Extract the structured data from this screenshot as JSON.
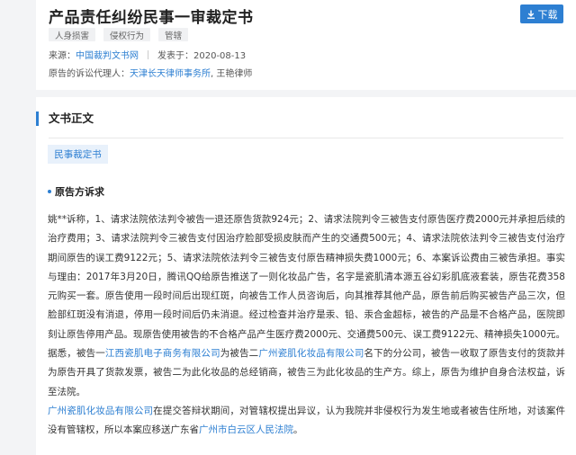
{
  "header": {
    "title": "产品责任纠纷民事一审裁定书",
    "download_label": "下载",
    "tags": [
      "人身损害",
      "侵权行为",
      "管辖"
    ],
    "source_label": "来源：",
    "source_value": "中国裁判文书网",
    "published_label": "发表于：",
    "published_value": "2020-08-13",
    "agent_label": "原告的诉讼代理人：",
    "agent_firm": "天津长天律师事务所",
    "agent_sep": ", ",
    "agent_name": "王艳律师"
  },
  "body": {
    "section_title": "文书正文",
    "doc_type": "民事裁定书",
    "subsection_title": "原告方诉求",
    "para1": "姚**诉称，1、请求法院依法判令被告一退还原告货款924元；2、请求法院判令三被告支付原告医疗费2000元并承担后续的治疗费用；3、请求法院判令三被告支付因治疗脸部受损皮肤而产生的交通费500元；4、请求法院依法判令三被告支付治疗期间原告的误工费9122元；5、请求法院依法判令三被告支付原告精神损失费1000元；6、本案诉讼费由三被告承担。事实与理由：2017年3月20日，腾讯QQ给原告推送了一则化妆品广告，名字是瓷肌清本源五谷幻彩肌底液套装，原告花费358元购买一套。原告使用一段时间后出现红斑，向被告工作人员咨询后，向其推荐其他产品，原告前后购买被告产品三次，但脸部红斑没有消退，停用一段时间后仍未消退。经过检查并治疗是汞、铅、汞合金超标，被告的产品是不合格产品，医院即刻让原告停用产品。现原告使用被告的不合格产品产生医疗费2000元、交通费500元、误工费9122元、精神损失1000元。据悉，被告一",
    "para1_link1": "江西瓷肌电子商务有限公司",
    "para1_mid": "为被告二",
    "para1_link2": "广州瓷肌化妆品有限公司",
    "para1_end": "名下的分公司，被告一收取了原告支付的货款并为原告开具了货款发票，被告二为此化妆品的总经销商，被告三为此化妆品的生产方。综上，原告为维护自身合法权益，诉至法院。",
    "para2_link1": "广州瓷肌化妆品有限公司",
    "para2_mid": "在提交答辩状期间，对管辖权提出异议，认为我院并非侵权行为发生地或者被告住所地，对该案件没有管辖权，所以本案应移送广东省",
    "para2_link2": "广州市白云区人民法院",
    "para2_end": "。"
  }
}
